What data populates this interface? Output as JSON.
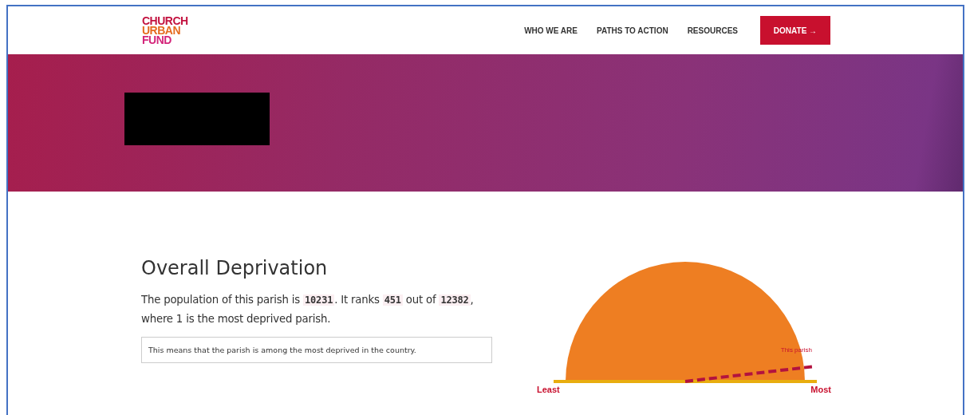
{
  "header": {
    "logo": [
      "CHURCH",
      "URBAN",
      "FUND"
    ],
    "nav": [
      {
        "label": "WHO WE ARE"
      },
      {
        "label": "PATHS TO ACTION"
      },
      {
        "label": "RESOURCES"
      }
    ],
    "donate": {
      "label": "DONATE",
      "arrow": "→"
    }
  },
  "section": {
    "title": "Overall Deprivation",
    "intro": "The population of this parish is **10231**. It ranks **451** out of **12382**, where 1 is the most deprived parish.",
    "note": "This means that the parish is among the most deprived in the country.",
    "gauge": {
      "marker_label": "This parish",
      "min_label": "Least",
      "max_label": "Most"
    }
  }
}
